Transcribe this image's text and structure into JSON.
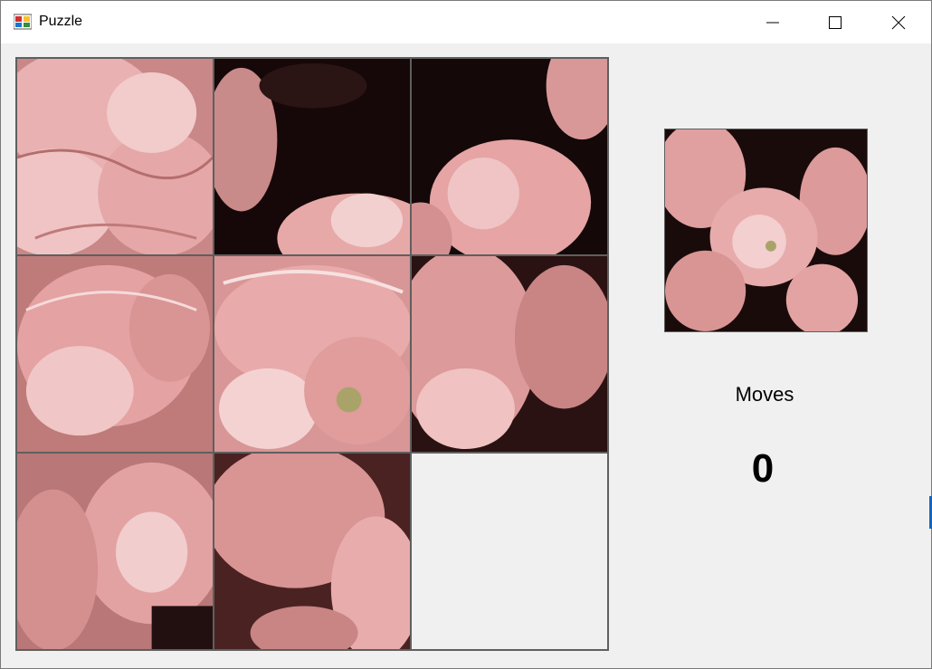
{
  "window": {
    "title": "Puzzle",
    "controls": {
      "minimize": "minimize-icon",
      "maximize": "maximize-icon",
      "close": "close-icon"
    }
  },
  "game": {
    "moves_label": "Moves",
    "moves_count": "0"
  },
  "colors": {
    "background": "#f0f0f0",
    "tile_border": "#5f5f5f",
    "petal": "#e6a0a0",
    "petal_light": "#f3cfcf",
    "petal_dark": "#b86a6a",
    "shadow": "#1a0d0d"
  }
}
